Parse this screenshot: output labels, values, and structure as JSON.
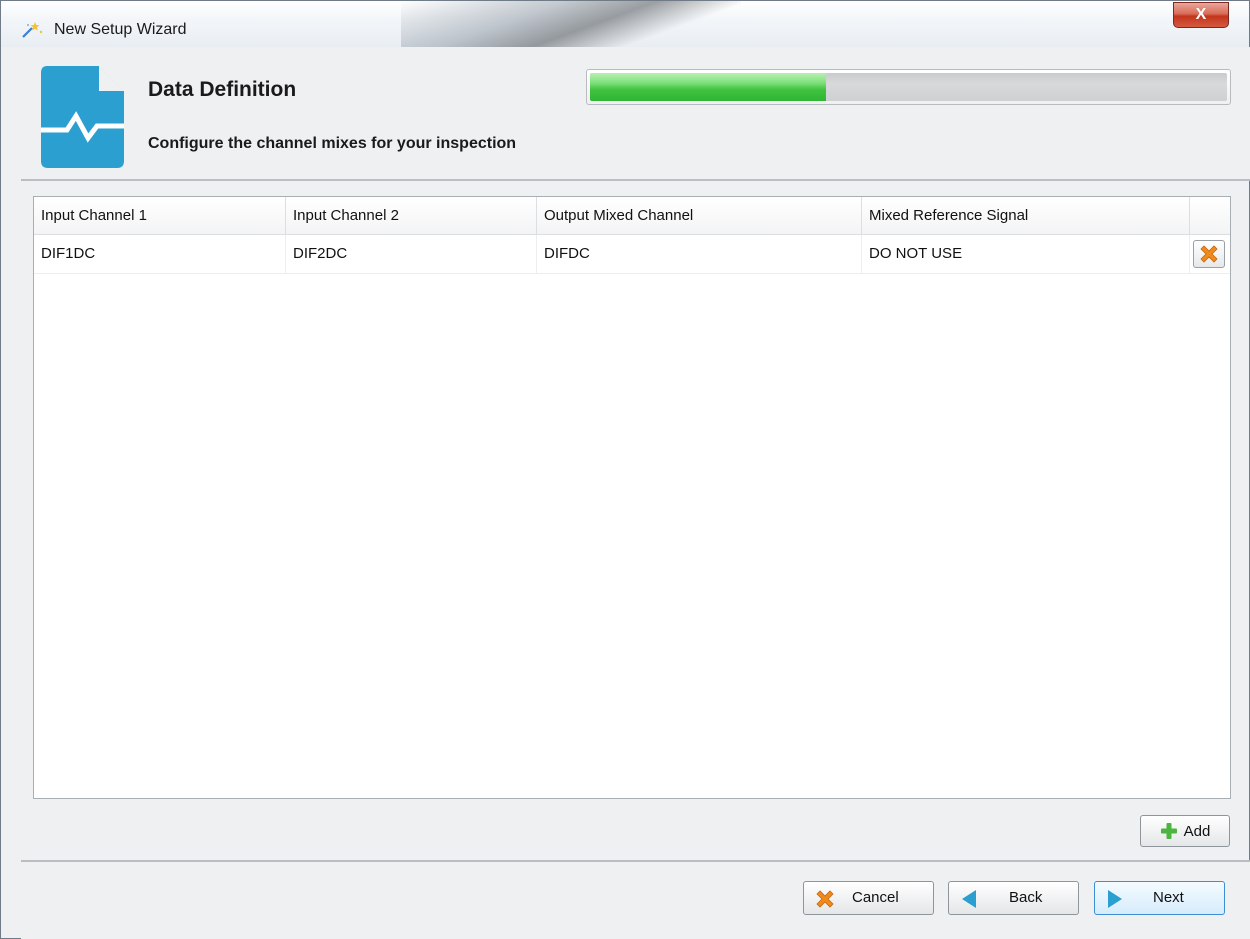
{
  "window": {
    "title": "New Setup Wizard",
    "close_label": "X"
  },
  "header": {
    "title": "Data Definition",
    "subtitle": "Configure the channel mixes for your inspection",
    "progress_fraction": 0.37,
    "colors": {
      "icon": "#2a9fd0",
      "progress": "#3fc23f"
    }
  },
  "table": {
    "columns": [
      "Input Channel 1",
      "Input Channel 2",
      "Output Mixed Channel",
      "Mixed Reference Signal"
    ],
    "rows": [
      [
        "DIF1DC",
        "DIF2DC",
        "DIFDC",
        "DO NOT USE"
      ]
    ]
  },
  "buttons": {
    "add": "Add",
    "cancel": "Cancel",
    "back": "Back",
    "next": "Next"
  },
  "icons": [
    "wizard-wand-icon",
    "document-signal-icon",
    "delete-x-icon",
    "add-plus-icon",
    "cancel-x-icon",
    "back-arrow-icon",
    "next-arrow-icon"
  ]
}
